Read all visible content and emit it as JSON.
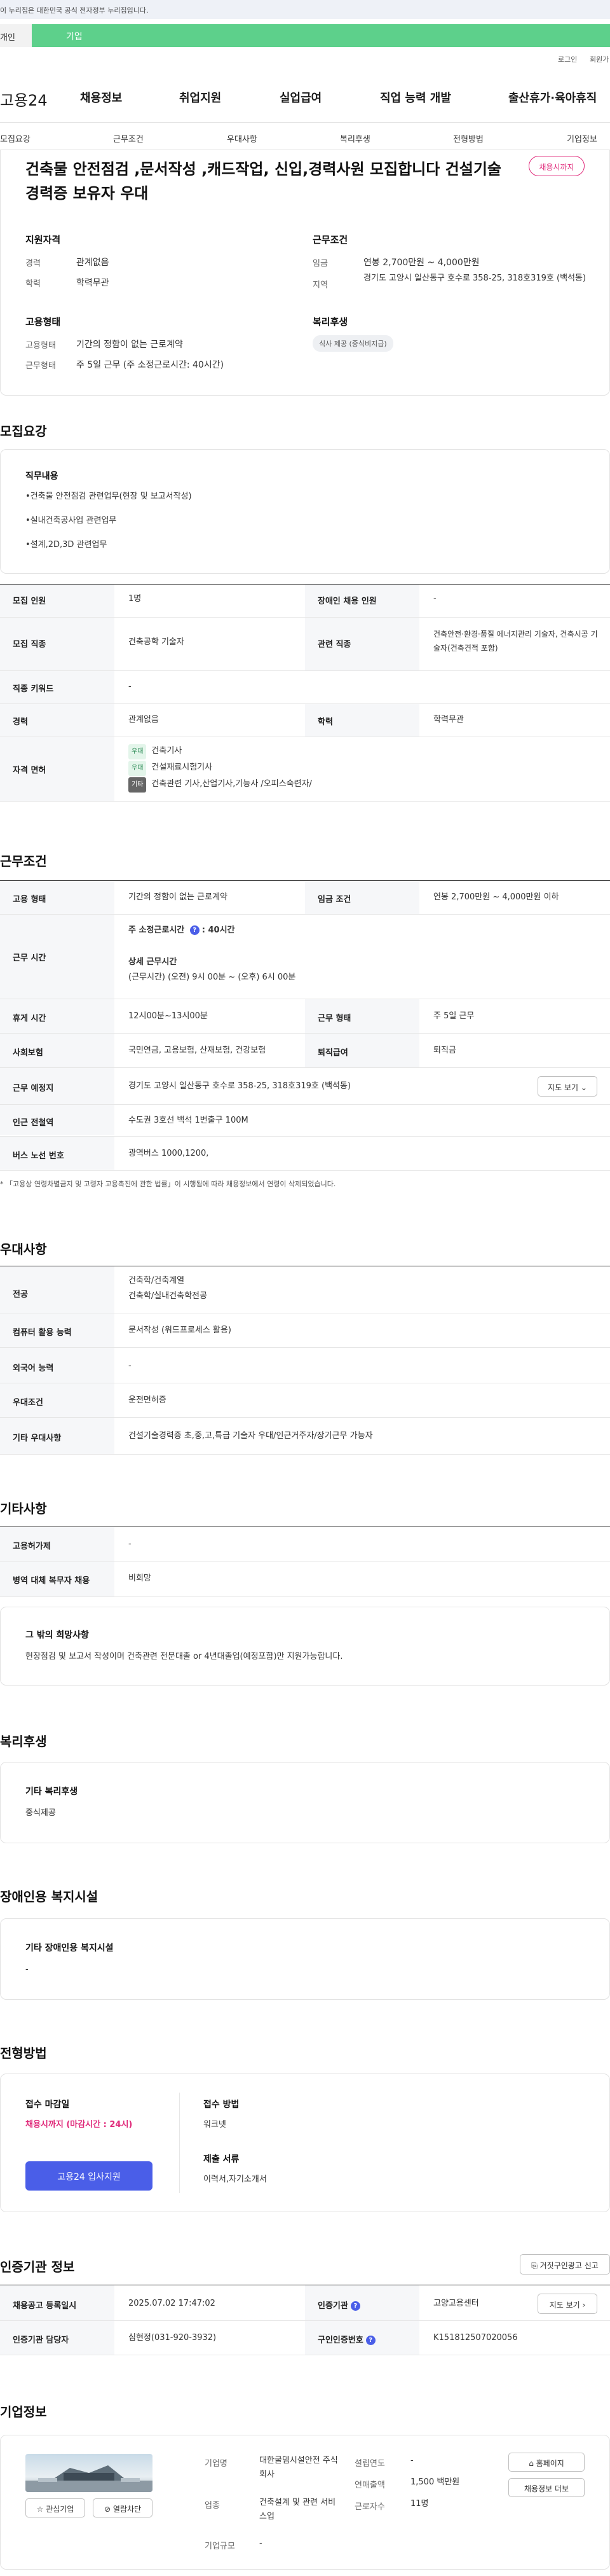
{
  "banner": {
    "text": "이 누리집은 대한민국 공식 전자정부 누리집입니다."
  },
  "utility": {
    "login": "로그인",
    "join": "회원가"
  },
  "tabs": {
    "individual": "개인",
    "business": "기업"
  },
  "logo": {
    "text": "고용24"
  },
  "gnb": [
    "채용정보",
    "취업지원",
    "실업급여",
    "직업 능력 개발",
    "출산휴가·육아휴직"
  ],
  "subnav": [
    "모집요강",
    "근무조건",
    "우대사항",
    "복리후생",
    "전형방법",
    "기업정보"
  ],
  "summary": {
    "title": "건축물 안전점검 ,문서작성 ,캐드작업, 신입,경력사원 모집합니다 건설기술 경력증 보유자 우대",
    "status_badge": "채용시까지",
    "applicant": {
      "heading": "지원자격",
      "career_label": "경력",
      "career_value": "관계없음",
      "education_label": "학력",
      "education_value": "학력무관"
    },
    "work": {
      "heading": "근무조건",
      "wage_label": "임금",
      "wage_value": "연봉 2,700만원 ~ 4,000만원",
      "region_label": "지역",
      "region_value": "경기도 고양시 일산동구 호수로 358-25, 318호319호 (백석동)"
    },
    "employment": {
      "heading": "고용형태",
      "type_label": "고용형태",
      "type_value": "기간의 정함이 없는 근로계약",
      "hours_label": "근무형태",
      "hours_value": "주 5일 근무 (주 소정근로시간: 40시간)"
    },
    "welfare": {
      "heading": "복리후생",
      "pill": "식사 제공 (중식비지급)"
    }
  },
  "recruit": {
    "section_title": "모집요강",
    "duty_heading": "직무내용",
    "duties": [
      "•건축물 안전점검 관련업무(현장 및 보고서작성)",
      "•실내건축공사업 관련업무",
      "•설계,2D,3D 관련업무"
    ],
    "people_label": "모집 인원",
    "people_value": "1명",
    "disabled_label": "장애인 채용 인원",
    "disabled_value": "-",
    "job_label": "모집 직종",
    "job_value": "건축공학 기술자",
    "related_label": "관련 직종",
    "related_value": "건축안전·환경·품질 에너지관리 기술자, 건축시공 기술자(건축견적 포함)",
    "keyword_label": "직종 키워드",
    "keyword_value": "-",
    "career_label": "경력",
    "career_value": "관계없음",
    "edu_label": "학력",
    "edu_value": "학력무관",
    "license_label": "자격 면허",
    "licenses": [
      {
        "tag": "우대",
        "name": "건축기사"
      },
      {
        "tag": "우대",
        "name": "건설재료시험기사"
      },
      {
        "tag": "기타",
        "name": "건축관련 기사,산업기사,기능사 /오피스숙련자/"
      }
    ]
  },
  "conditions": {
    "section_title": "근무조건",
    "emp_label": "고용 형태",
    "emp_value": "기간의 정함이 없는 근로계약",
    "wage_label": "임금 조건",
    "wage_value": "연봉 2,700만원 ~ 4,000만원 이하",
    "time_label": "근무 시간",
    "weekly_hours": "주 소정근로시간 ",
    "weekly_hours_value": ": 40시간",
    "detail_heading": "상세 근무시간",
    "detail_value": "(근무시간) (오전) 9시 00분 ~ (오후) 6시 00분",
    "rest_label": "휴게 시간",
    "rest_value": "12시00분~13시00분",
    "form_label": "근무 형태",
    "form_value": "주 5일 근무",
    "insurance_label": "사회보험",
    "insurance_value": "국민연금, 고용보험, 산재보험, 건강보험",
    "retire_label": "퇴직급여",
    "retire_value": "퇴직금",
    "place_label": "근무 예정지",
    "place_value": "경기도 고양시 일산동구 호수로 358-25, 318호319호 (백석동)",
    "map_button": "지도 보기",
    "subway_label": "인근 전철역",
    "subway_value": "수도권 3호선 백석 1번출구 100M",
    "bus_label": "버스 노선 번호",
    "bus_value": "광역버스 1000,1200,",
    "note": "* 「고용상 연령차별금지 및 고령자 고용촉진에 관한 법률」이 시행됨에 따라 채용정보에서 연령이 삭제되었습니다."
  },
  "preference": {
    "section_title": "우대사항",
    "major_label": "전공",
    "major_values": [
      "건축학/건축계열",
      "건축학/실내건축학전공"
    ],
    "pc_label": "컴퓨터 활용 능력",
    "pc_value": "문서작성 (워드프로세스 활용)",
    "lang_label": "외국어 능력",
    "lang_value": "-",
    "cond_label": "우대조건",
    "cond_value": "운전면허증",
    "etc_label": "기타 우대사항",
    "etc_value": "건설기술경력증 초,중,고,특급 기술자 우대/인근거주자/장기근무 가능자"
  },
  "other": {
    "section_title": "기타사항",
    "permit_label": "고용허가제",
    "permit_value": "-",
    "military_label": "병역 대체 복무자 채용",
    "military_value": "비희망",
    "wish_heading": "그 밖의 희망사항",
    "wish_value": "현장점검 및 보고서 작성이며 건축관련 전문대졸 or 4년대졸업(예정포함)만 지원가능합니다."
  },
  "welfare": {
    "section_title": "복리후생",
    "heading": "기타 복리후생",
    "value": "중식제공"
  },
  "facility": {
    "section_title": "장애인용 복지시설",
    "heading": "기타 장애인용 복지시설",
    "value": "-"
  },
  "process": {
    "section_title": "전형방법",
    "deadline_heading": "접수 마감일",
    "deadline_value": "채용시까지 (마감시간 : 24시)",
    "apply_button": "고용24 입사지원",
    "method_heading": "접수 방법",
    "method_value": "워크넷",
    "docs_heading": "제출 서류",
    "docs_value": "이력서,자기소개서"
  },
  "cert": {
    "section_title": "인증기관 정보",
    "report_button": "거짓구인광고 신고",
    "reg_label": "채용공고 등록일시",
    "reg_value": "2025.07.02 17:47:02",
    "org_label": "인증기관",
    "org_value": "고양고용센터",
    "map_button": "지도 보기",
    "manager_label": "인증기관 담당자",
    "manager_value": "심현정(031-920-3932)",
    "number_label": "구인인증번호",
    "number_value": "K151812507020056"
  },
  "company": {
    "section_title": "기업정보",
    "fav_button": "관심기업",
    "block_button": "열람차단",
    "name_label": "기업명",
    "name_value": "대한굴뎀시설안전 주식회사",
    "industry_label": "업종",
    "industry_value": "건축설계 및 관련 서비스업",
    "size_label": "기업규모",
    "size_value": "-",
    "founded_label": "설립연도",
    "founded_value": "-",
    "sales_label": "연매출액",
    "sales_value": "1,500 백만원",
    "staff_label": "근로자수",
    "staff_value": "11명",
    "home_button": "홈페이지",
    "jobs_button": "채용정보 더보"
  },
  "colors": {
    "accent": "#4a5ee8",
    "business_tab": "#5dd08b",
    "highlight": "#e0297a"
  }
}
